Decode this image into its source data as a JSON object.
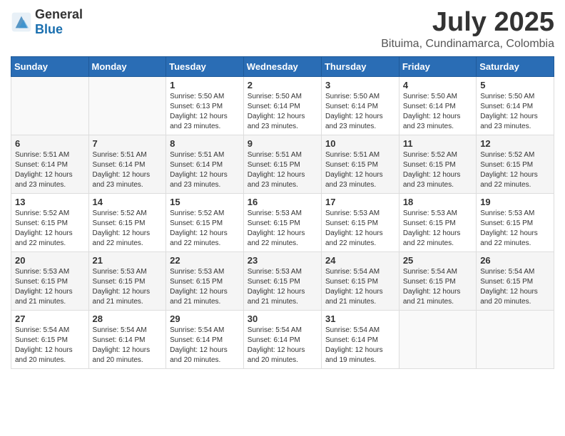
{
  "logo": {
    "general": "General",
    "blue": "Blue"
  },
  "title": "July 2025",
  "subtitle": "Bituima, Cundinamarca, Colombia",
  "days_of_week": [
    "Sunday",
    "Monday",
    "Tuesday",
    "Wednesday",
    "Thursday",
    "Friday",
    "Saturday"
  ],
  "weeks": [
    [
      {
        "day": "",
        "sunrise": "",
        "sunset": "",
        "daylight": ""
      },
      {
        "day": "",
        "sunrise": "",
        "sunset": "",
        "daylight": ""
      },
      {
        "day": "1",
        "sunrise": "Sunrise: 5:50 AM",
        "sunset": "Sunset: 6:13 PM",
        "daylight": "Daylight: 12 hours and 23 minutes."
      },
      {
        "day": "2",
        "sunrise": "Sunrise: 5:50 AM",
        "sunset": "Sunset: 6:14 PM",
        "daylight": "Daylight: 12 hours and 23 minutes."
      },
      {
        "day": "3",
        "sunrise": "Sunrise: 5:50 AM",
        "sunset": "Sunset: 6:14 PM",
        "daylight": "Daylight: 12 hours and 23 minutes."
      },
      {
        "day": "4",
        "sunrise": "Sunrise: 5:50 AM",
        "sunset": "Sunset: 6:14 PM",
        "daylight": "Daylight: 12 hours and 23 minutes."
      },
      {
        "day": "5",
        "sunrise": "Sunrise: 5:50 AM",
        "sunset": "Sunset: 6:14 PM",
        "daylight": "Daylight: 12 hours and 23 minutes."
      }
    ],
    [
      {
        "day": "6",
        "sunrise": "Sunrise: 5:51 AM",
        "sunset": "Sunset: 6:14 PM",
        "daylight": "Daylight: 12 hours and 23 minutes."
      },
      {
        "day": "7",
        "sunrise": "Sunrise: 5:51 AM",
        "sunset": "Sunset: 6:14 PM",
        "daylight": "Daylight: 12 hours and 23 minutes."
      },
      {
        "day": "8",
        "sunrise": "Sunrise: 5:51 AM",
        "sunset": "Sunset: 6:14 PM",
        "daylight": "Daylight: 12 hours and 23 minutes."
      },
      {
        "day": "9",
        "sunrise": "Sunrise: 5:51 AM",
        "sunset": "Sunset: 6:15 PM",
        "daylight": "Daylight: 12 hours and 23 minutes."
      },
      {
        "day": "10",
        "sunrise": "Sunrise: 5:51 AM",
        "sunset": "Sunset: 6:15 PM",
        "daylight": "Daylight: 12 hours and 23 minutes."
      },
      {
        "day": "11",
        "sunrise": "Sunrise: 5:52 AM",
        "sunset": "Sunset: 6:15 PM",
        "daylight": "Daylight: 12 hours and 23 minutes."
      },
      {
        "day": "12",
        "sunrise": "Sunrise: 5:52 AM",
        "sunset": "Sunset: 6:15 PM",
        "daylight": "Daylight: 12 hours and 22 minutes."
      }
    ],
    [
      {
        "day": "13",
        "sunrise": "Sunrise: 5:52 AM",
        "sunset": "Sunset: 6:15 PM",
        "daylight": "Daylight: 12 hours and 22 minutes."
      },
      {
        "day": "14",
        "sunrise": "Sunrise: 5:52 AM",
        "sunset": "Sunset: 6:15 PM",
        "daylight": "Daylight: 12 hours and 22 minutes."
      },
      {
        "day": "15",
        "sunrise": "Sunrise: 5:52 AM",
        "sunset": "Sunset: 6:15 PM",
        "daylight": "Daylight: 12 hours and 22 minutes."
      },
      {
        "day": "16",
        "sunrise": "Sunrise: 5:53 AM",
        "sunset": "Sunset: 6:15 PM",
        "daylight": "Daylight: 12 hours and 22 minutes."
      },
      {
        "day": "17",
        "sunrise": "Sunrise: 5:53 AM",
        "sunset": "Sunset: 6:15 PM",
        "daylight": "Daylight: 12 hours and 22 minutes."
      },
      {
        "day": "18",
        "sunrise": "Sunrise: 5:53 AM",
        "sunset": "Sunset: 6:15 PM",
        "daylight": "Daylight: 12 hours and 22 minutes."
      },
      {
        "day": "19",
        "sunrise": "Sunrise: 5:53 AM",
        "sunset": "Sunset: 6:15 PM",
        "daylight": "Daylight: 12 hours and 22 minutes."
      }
    ],
    [
      {
        "day": "20",
        "sunrise": "Sunrise: 5:53 AM",
        "sunset": "Sunset: 6:15 PM",
        "daylight": "Daylight: 12 hours and 21 minutes."
      },
      {
        "day": "21",
        "sunrise": "Sunrise: 5:53 AM",
        "sunset": "Sunset: 6:15 PM",
        "daylight": "Daylight: 12 hours and 21 minutes."
      },
      {
        "day": "22",
        "sunrise": "Sunrise: 5:53 AM",
        "sunset": "Sunset: 6:15 PM",
        "daylight": "Daylight: 12 hours and 21 minutes."
      },
      {
        "day": "23",
        "sunrise": "Sunrise: 5:53 AM",
        "sunset": "Sunset: 6:15 PM",
        "daylight": "Daylight: 12 hours and 21 minutes."
      },
      {
        "day": "24",
        "sunrise": "Sunrise: 5:54 AM",
        "sunset": "Sunset: 6:15 PM",
        "daylight": "Daylight: 12 hours and 21 minutes."
      },
      {
        "day": "25",
        "sunrise": "Sunrise: 5:54 AM",
        "sunset": "Sunset: 6:15 PM",
        "daylight": "Daylight: 12 hours and 21 minutes."
      },
      {
        "day": "26",
        "sunrise": "Sunrise: 5:54 AM",
        "sunset": "Sunset: 6:15 PM",
        "daylight": "Daylight: 12 hours and 20 minutes."
      }
    ],
    [
      {
        "day": "27",
        "sunrise": "Sunrise: 5:54 AM",
        "sunset": "Sunset: 6:15 PM",
        "daylight": "Daylight: 12 hours and 20 minutes."
      },
      {
        "day": "28",
        "sunrise": "Sunrise: 5:54 AM",
        "sunset": "Sunset: 6:14 PM",
        "daylight": "Daylight: 12 hours and 20 minutes."
      },
      {
        "day": "29",
        "sunrise": "Sunrise: 5:54 AM",
        "sunset": "Sunset: 6:14 PM",
        "daylight": "Daylight: 12 hours and 20 minutes."
      },
      {
        "day": "30",
        "sunrise": "Sunrise: 5:54 AM",
        "sunset": "Sunset: 6:14 PM",
        "daylight": "Daylight: 12 hours and 20 minutes."
      },
      {
        "day": "31",
        "sunrise": "Sunrise: 5:54 AM",
        "sunset": "Sunset: 6:14 PM",
        "daylight": "Daylight: 12 hours and 19 minutes."
      },
      {
        "day": "",
        "sunrise": "",
        "sunset": "",
        "daylight": ""
      },
      {
        "day": "",
        "sunrise": "",
        "sunset": "",
        "daylight": ""
      }
    ]
  ]
}
